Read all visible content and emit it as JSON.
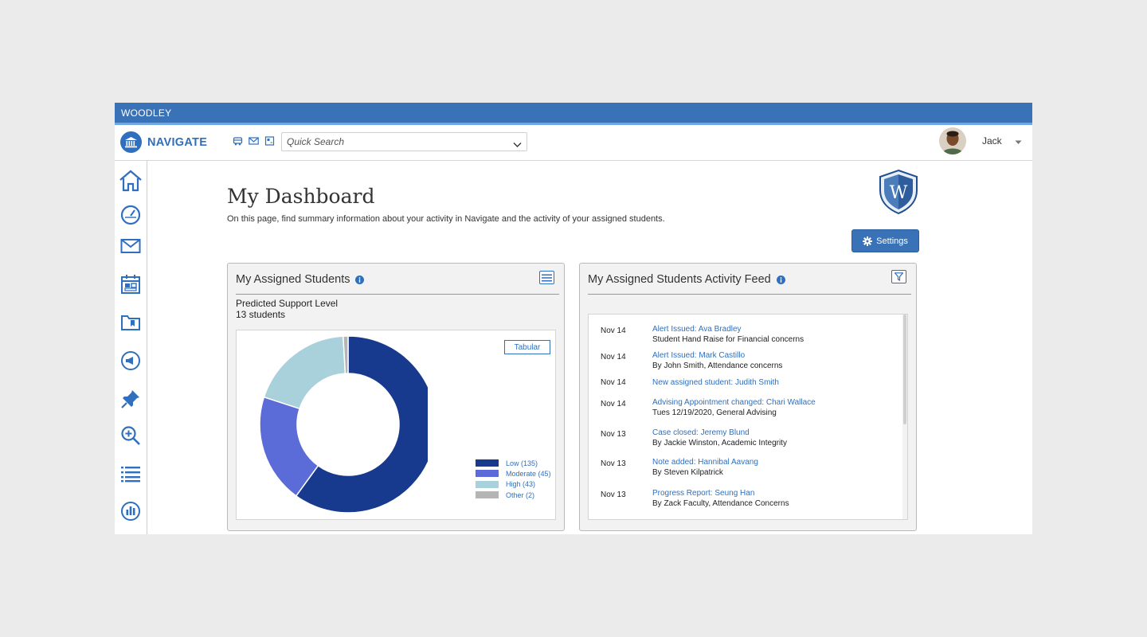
{
  "brand": {
    "institution": "WOODLEY",
    "app_name": "NAVIGATE"
  },
  "topnav": {
    "quick_icons": [
      "bus-icon",
      "mail-icon",
      "grid-icon"
    ],
    "search_placeholder": "Quick Search",
    "user_name": "Jack"
  },
  "sidebar": {
    "items": [
      "home-icon",
      "dashboard-gauge-icon",
      "mail-icon",
      "calendar-icon",
      "folder-icon",
      "megaphone-icon",
      "pin-icon",
      "zoom-search-icon",
      "list-icon",
      "reports-chart-icon"
    ]
  },
  "page": {
    "title": "My Dashboard",
    "subtitle": "On this page, find summary information about your activity in Navigate and the activity of your assigned students.",
    "crest_letter": "W",
    "settings_label": "Settings"
  },
  "assigned_students": {
    "title": "My Assigned Students",
    "metric_label": "Predicted Support Level",
    "count_label": "13 students",
    "tabular_label": "Tabular"
  },
  "chart_data": {
    "type": "pie",
    "donut": true,
    "categories": [
      "Low",
      "Moderate",
      "High",
      "Other"
    ],
    "values": [
      135,
      45,
      43,
      2
    ],
    "legend_labels": [
      "Low (135)",
      "Moderate (45)",
      "High (43)",
      "Other (2)"
    ],
    "colors": [
      "#173a8e",
      "#5b6bd8",
      "#a9d1db",
      "#b5b5b5"
    ],
    "legend_position": "bottom-right"
  },
  "activity_feed": {
    "title": "My Assigned Students Activity Feed",
    "items": [
      {
        "date": "Nov 14",
        "link": "Alert Issued: Ava Bradley",
        "detail": "Student Hand Raise for Financial concerns"
      },
      {
        "date": "Nov 14",
        "link": "Alert Issued: Mark Castillo",
        "detail": "By John Smith, Attendance concerns"
      },
      {
        "date": "Nov 14",
        "link": "New assigned student: Judith Smith",
        "detail": ""
      },
      {
        "date": "Nov 14",
        "link": "Advising Appointment changed: Chari Wallace",
        "detail": "Tues 12/19/2020, General Advising"
      },
      {
        "date": "Nov 13",
        "link": "Case closed: Jeremy Blund",
        "detail": "By Jackie Winston, Academic Integrity"
      },
      {
        "date": "Nov 13",
        "link": "Note added: Hannibal Aavang",
        "detail": "By Steven Kilpatrick"
      },
      {
        "date": "Nov 13",
        "link": "Progress Report: Seung Han",
        "detail": "By Zack Faculty, Attendance Concerns"
      }
    ]
  }
}
